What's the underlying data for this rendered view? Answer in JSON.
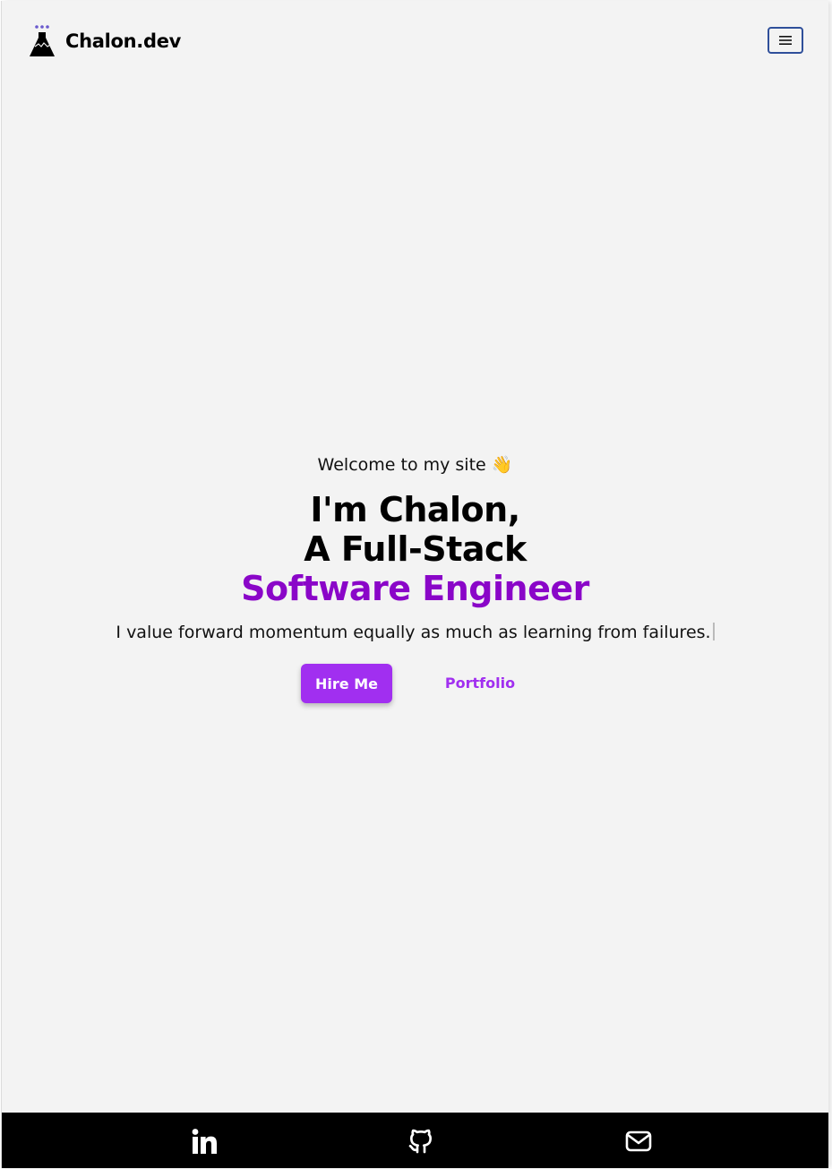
{
  "header": {
    "brand_name": "Chalon.dev",
    "logo_icon": "flask-logo-icon",
    "menu_icon": "hamburger-menu-icon",
    "menu_border_color": "#2f4f9a"
  },
  "hero": {
    "welcome_text": "Welcome to my site",
    "welcome_emoji": "👋",
    "title_line1": "I'm Chalon,",
    "title_line2": "A Full-Stack",
    "title_line3": "Software Engineer",
    "tagline": "I value forward momentum equally as much as learning from failures.",
    "hire_label": "Hire Me",
    "portfolio_label": "Portfolio",
    "accent_color": "#8a06c8",
    "button_color": "#a12ff0"
  },
  "footer": {
    "background": "#000000",
    "links": [
      {
        "icon": "linkedin-icon"
      },
      {
        "icon": "github-icon"
      },
      {
        "icon": "mail-icon"
      }
    ]
  }
}
